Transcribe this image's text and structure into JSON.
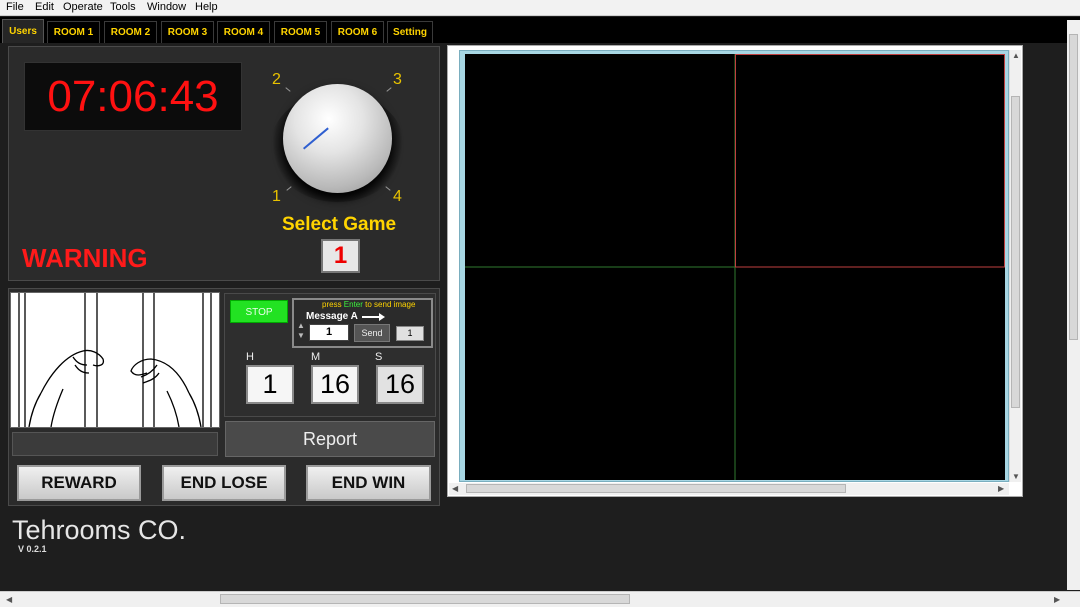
{
  "menu": [
    "File",
    "Edit",
    "Operate",
    "Tools",
    "Window",
    "Help"
  ],
  "tabs": [
    "Users",
    "ROOM 1",
    "ROOM 2",
    "ROOM 3",
    "ROOM 4",
    "ROOM 5",
    "ROOM 6",
    "Setting"
  ],
  "active_tab": "Users",
  "clock": "07:06:43",
  "knob": {
    "labels": [
      "1",
      "2",
      "3",
      "4"
    ],
    "selected": 1
  },
  "select_game": {
    "label": "Select Game",
    "value": "1"
  },
  "warning": "WARNING",
  "controls": {
    "stop_label": "STOP",
    "press_prefix": "press ",
    "press_key": "Enter",
    "press_suffix": " to send image",
    "message_label": "Message  A",
    "message_value": "1",
    "send_label": "Send",
    "send_value": "1"
  },
  "timer": {
    "h_label": "H",
    "m_label": "M",
    "s_label": "S",
    "h_value": "1",
    "m_value": "16",
    "s_value": "16"
  },
  "report_label": "Report",
  "buttons": {
    "reward": "REWARD",
    "end_lose": "END LOSE",
    "end_win": "END WIN"
  },
  "company": "Tehrooms CO.",
  "version": "V 0.2.1",
  "colors": {
    "clock": "#ff1111",
    "warning": "#ff1a1a",
    "tab_text": "#ffd400",
    "stop": "#22e222"
  }
}
